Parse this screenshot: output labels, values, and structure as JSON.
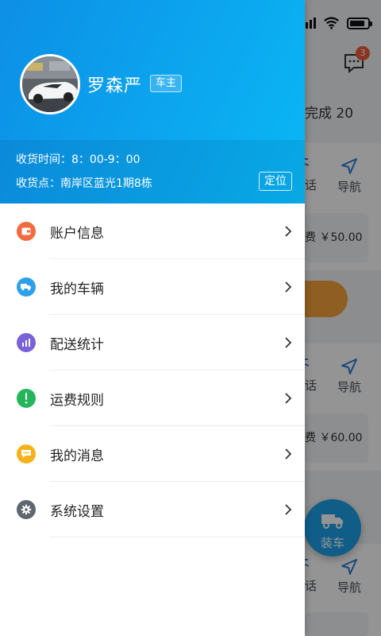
{
  "background": {
    "message_badge": "3",
    "tabs_partial": "完成 20",
    "cards": [
      {
        "call_partial": "话",
        "nav_label": "导航",
        "fee_partial": "费 ￥50.00"
      },
      {
        "call_partial": "话",
        "nav_label": "导航",
        "fee_partial": "费 ￥60.00"
      },
      {
        "call_partial": "话",
        "nav_label": "导航"
      }
    ],
    "fab_label": "装车"
  },
  "drawer": {
    "user": {
      "name": "罗森严",
      "role": "车主"
    },
    "receive_time": "收货时间：8：00-9：00",
    "receive_point": "收货点：南岸区蓝光1期8栋",
    "locate_label": "定位",
    "menu": [
      {
        "label": "账户信息",
        "icon": "wallet-icon",
        "color": "#f26b3f"
      },
      {
        "label": "我的车辆",
        "icon": "truck-icon",
        "color": "#2e9fea"
      },
      {
        "label": "配送统计",
        "icon": "chart-icon",
        "color": "#7b61d8"
      },
      {
        "label": "运费规则",
        "icon": "exclamation-icon",
        "color": "#27b55c"
      },
      {
        "label": "我的消息",
        "icon": "chat-icon",
        "color": "#f6b21b"
      },
      {
        "label": "系统设置",
        "icon": "gear-icon",
        "color": "#5f6670"
      }
    ]
  },
  "colors": {
    "header_start": "#0d8fe6",
    "header_end": "#0ab8f5",
    "fab": "#1ca3ea",
    "orange": "#f5a23b"
  }
}
